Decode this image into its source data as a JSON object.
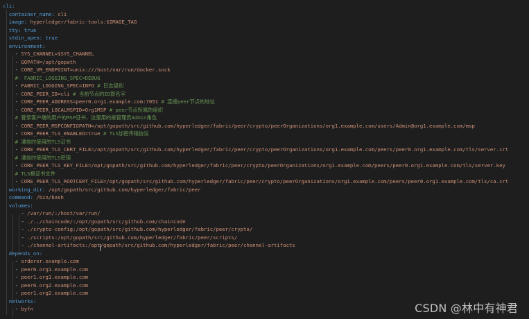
{
  "editor": {
    "colors": {
      "background": "#1e1e1e",
      "key": "#569cd6",
      "value": "#ce9178",
      "comment": "#6a9955",
      "text": "#d4d4d4"
    },
    "lines": [
      {
        "key": "cli:"
      },
      {
        "key": "  container_name:",
        "value": " cli"
      },
      {
        "key": "  image:",
        "value": " hyperledger/fabric-tools:$IMAGE_TAG"
      },
      {
        "key": "  tty:",
        "bool": " true"
      },
      {
        "key": "  stdin_open:",
        "bool": " true"
      },
      {
        "key": "  environment:"
      },
      {
        "dash": "    - ",
        "value": "SYS_CHANNEL=$SYS_CHANNEL"
      },
      {
        "dash": "    - ",
        "value": "GOPATH=/opt/gopath"
      },
      {
        "dash": "    - ",
        "value": "CORE_VM_ENDPOINT=unix:///host/var/run/docker.sock"
      },
      {
        "comment": "    #- FABRIC_LOGGING_SPEC=DEBUG"
      },
      {
        "dash": "    - ",
        "value": "FABRIC_LOGGING_SPEC=INFO ",
        "comment": "# 日志级别"
      },
      {
        "dash": "    - ",
        "value": "CORE_PEER_ID=cli ",
        "comment": "# 当前节点的ID即名字"
      },
      {
        "dash": "    - ",
        "value": "CORE_PEER_ADDRESS=peer0.org1.example.com:7051 ",
        "comment": "# 连接peer节点的地址"
      },
      {
        "dash": "    - ",
        "value": "CORE_PEER_LOCALMSPID=Org1MSP ",
        "comment": "# peer节点所属的组织"
      },
      {
        "comment": "    # 登录客户端的用户的MSP证书，这里用的是管理员Admin角色"
      },
      {
        "dash": "    - ",
        "value": "CORE_PEER_MSPCONFIGPATH=/opt/gopath/src/github.com/hyperledger/fabric/peer/crypto/peerOrganizations/org1.example.com/users/Admin@org1.example.com/msp"
      },
      {
        "dash": "    - ",
        "value": "CORE_PEER_TLS_ENABLED=true ",
        "comment": "# TLS加密传输协议"
      },
      {
        "comment": "    # 通信时使用的TLS证书"
      },
      {
        "dash": "    - ",
        "value": "CORE_PEER_TLS_CERT_FILE=/opt/gopath/src/github.com/hyperledger/fabric/peer/crypto/peerOrganizations/org1.example.com/peers/peer0.org1.example.com/tls/server.crt"
      },
      {
        "comment": "    # 通信时使用的TLS密钥"
      },
      {
        "dash": "    - ",
        "value": "CORE_PEER_TLS_KEY_FILE=/opt/gopath/src/github.com/hyperledger/fabric/peer/crypto/peerOrganizations/org1.example.com/peers/peer0.org1.example.com/tls/server.key"
      },
      {
        "comment": "    # TLS根证书文件"
      },
      {
        "dash": "    - ",
        "value": "CORE_PEER_TLS_ROOTCERT_FILE=/opt/gopath/src/github.com/hyperledger/fabric/peer/crypto/peerOrganizations/org1.example.com/peers/peer0.org1.example.com/tls/ca.crt"
      },
      {
        "key": "  working_dir:",
        "value": " /opt/gopath/src/github.com/hyperledger/fabric/peer"
      },
      {
        "key": "  command:",
        "value": " /bin/bash"
      },
      {
        "key": "  volumes:"
      },
      {
        "dash": "      - ",
        "value": "/var/run/:/host/var/run/"
      },
      {
        "dash": "      - ",
        "value": "./../chaincode/:/opt/gopath/src/github.com/chaincode"
      },
      {
        "dash": "      - ",
        "value": "./crypto-config:/opt/gopath/src/github.com/hyperledger/fabric/peer/crypto/"
      },
      {
        "dash": "      - ",
        "value": "./scripts:/opt/gopath/src/github.com/hyperledger/fabric/peer/scripts/"
      },
      {
        "dash": "      - ",
        "value": "./channel-artifacts:/opt/gopath/src/github.com/hyperledger/fabric/peer/channel-artifacts"
      },
      {
        "key": "  depends_on:"
      },
      {
        "dash": "    - ",
        "value": "orderer.example.com"
      },
      {
        "dash": "    - ",
        "value": "peer0.org1.example.com"
      },
      {
        "dash": "    - ",
        "value": "peer1.org1.example.com"
      },
      {
        "dash": "    - ",
        "value": "peer0.org2.example.com"
      },
      {
        "dash": "    - ",
        "value": "peer1.org2.example.com"
      },
      {
        "key": "  networks:"
      },
      {
        "dash": "    - ",
        "value": "byfn"
      }
    ]
  },
  "watermark": "CSDN @林中有神君"
}
